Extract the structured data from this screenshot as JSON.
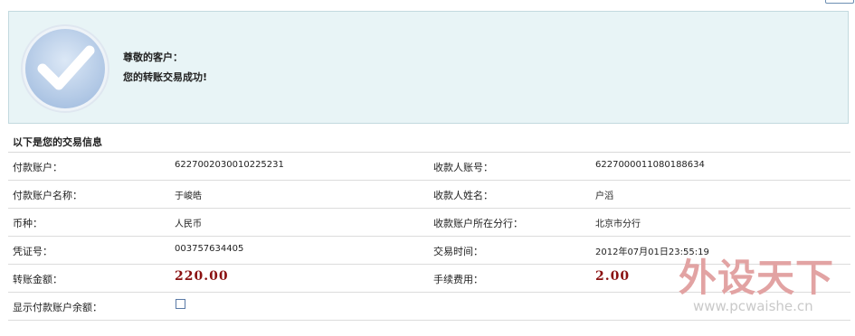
{
  "success": {
    "greeting": "尊敬的客户：",
    "message": "您的转账交易成功!",
    "icon": "checkmark-icon"
  },
  "info_header": "以下是您的交易信息",
  "rows": [
    {
      "l1": "付款账户：",
      "v1": "6227002030010225231",
      "l2": "收款人账号：",
      "v2": "6227000011080188634"
    },
    {
      "l1": "付款账户名称：",
      "v1": "于峻皓",
      "l2": "收款人姓名：",
      "v2": "户滔"
    },
    {
      "l1": "币种：",
      "v1": "人民币",
      "l2": "收款账户所在分行：",
      "v2": "北京市分行"
    },
    {
      "l1": "凭证号：",
      "v1": "003757634405",
      "l2": "交易时间：",
      "v2": "2012年07月01日23:55:19"
    },
    {
      "l1": "转账金额：",
      "v1": "220.00",
      "l2": "手续费用：",
      "v2": "2.00"
    }
  ],
  "show_balance": {
    "label": "显示付款账户余额：",
    "checked": false
  },
  "watermark": {
    "logo": "外设天下",
    "url": "www.pcwaishe.cn"
  },
  "colors": {
    "panel_bg": "#e8f4f6",
    "amount": "#8a1010",
    "checkbox_border": "#5a7aa6"
  }
}
